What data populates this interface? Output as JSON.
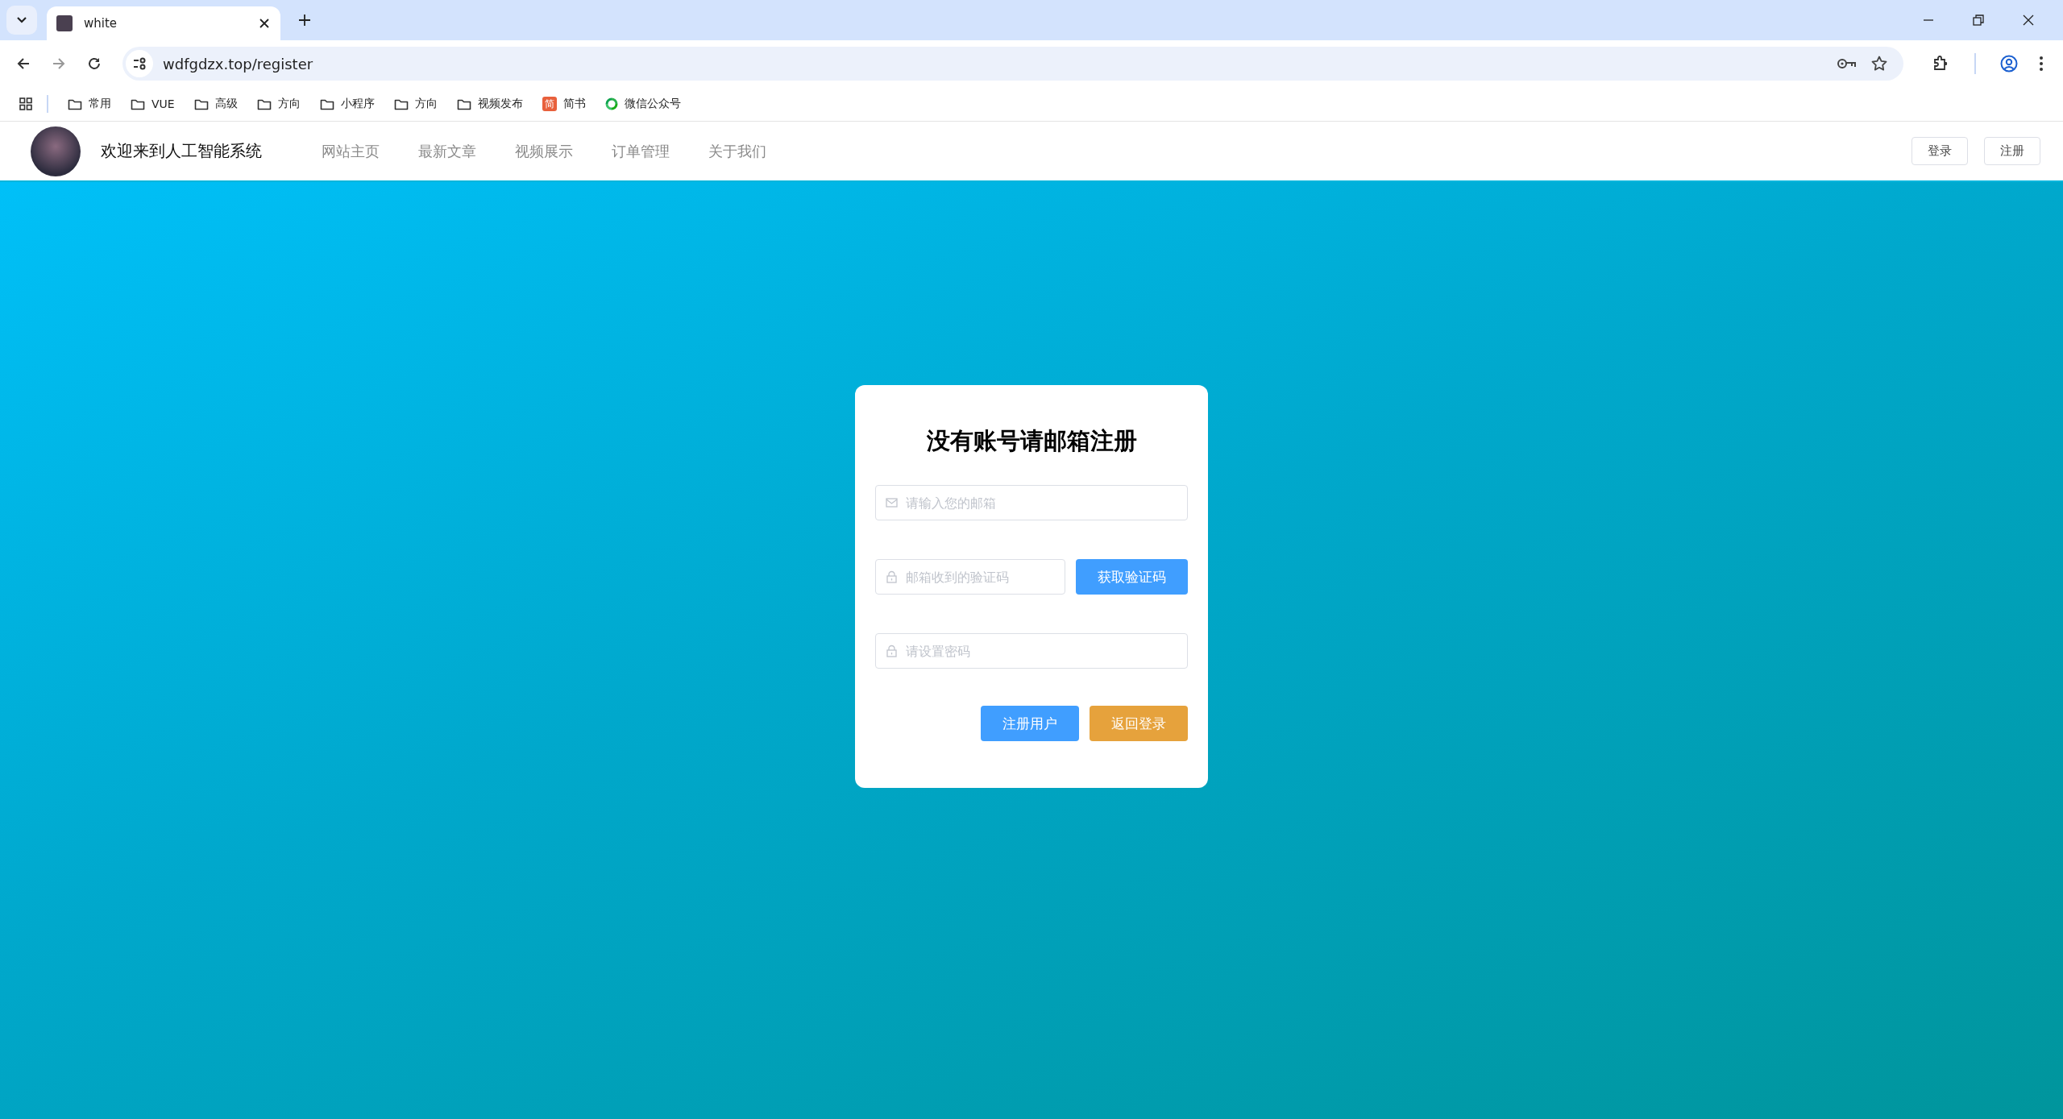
{
  "browser": {
    "tabs": [
      {
        "title": "white",
        "selected": true
      }
    ],
    "address": "wdfgdzx.top/register",
    "bookmarks": [
      {
        "label": "常用",
        "kind": "folder"
      },
      {
        "label": "VUE",
        "kind": "folder"
      },
      {
        "label": "高级",
        "kind": "folder"
      },
      {
        "label": "方向",
        "kind": "folder"
      },
      {
        "label": "小程序",
        "kind": "folder"
      },
      {
        "label": "方向",
        "kind": "folder"
      },
      {
        "label": "视频发布",
        "kind": "folder"
      },
      {
        "label": "简书",
        "kind": "badge",
        "badge": "简"
      },
      {
        "label": "微信公众号",
        "kind": "ring"
      }
    ]
  },
  "header": {
    "site_title": "欢迎来到人工智能系统",
    "nav": [
      {
        "label": "网站主页"
      },
      {
        "label": "最新文章"
      },
      {
        "label": "视频展示"
      },
      {
        "label": "订单管理"
      },
      {
        "label": "关于我们"
      }
    ],
    "auth_buttons": [
      {
        "label": "登录"
      },
      {
        "label": "注册"
      }
    ]
  },
  "form": {
    "title": "没有账号请邮箱注册",
    "fields": [
      {
        "kind": "email",
        "placeholder": "请输入您的邮箱"
      },
      {
        "kind": "code",
        "placeholder": "邮箱收到的验证码",
        "button": "获取验证码"
      },
      {
        "kind": "password",
        "placeholder": "请设置密码"
      }
    ],
    "actions": [
      {
        "label": "注册用户",
        "kind": "primary"
      },
      {
        "label": "返回登录",
        "kind": "warning"
      }
    ]
  }
}
